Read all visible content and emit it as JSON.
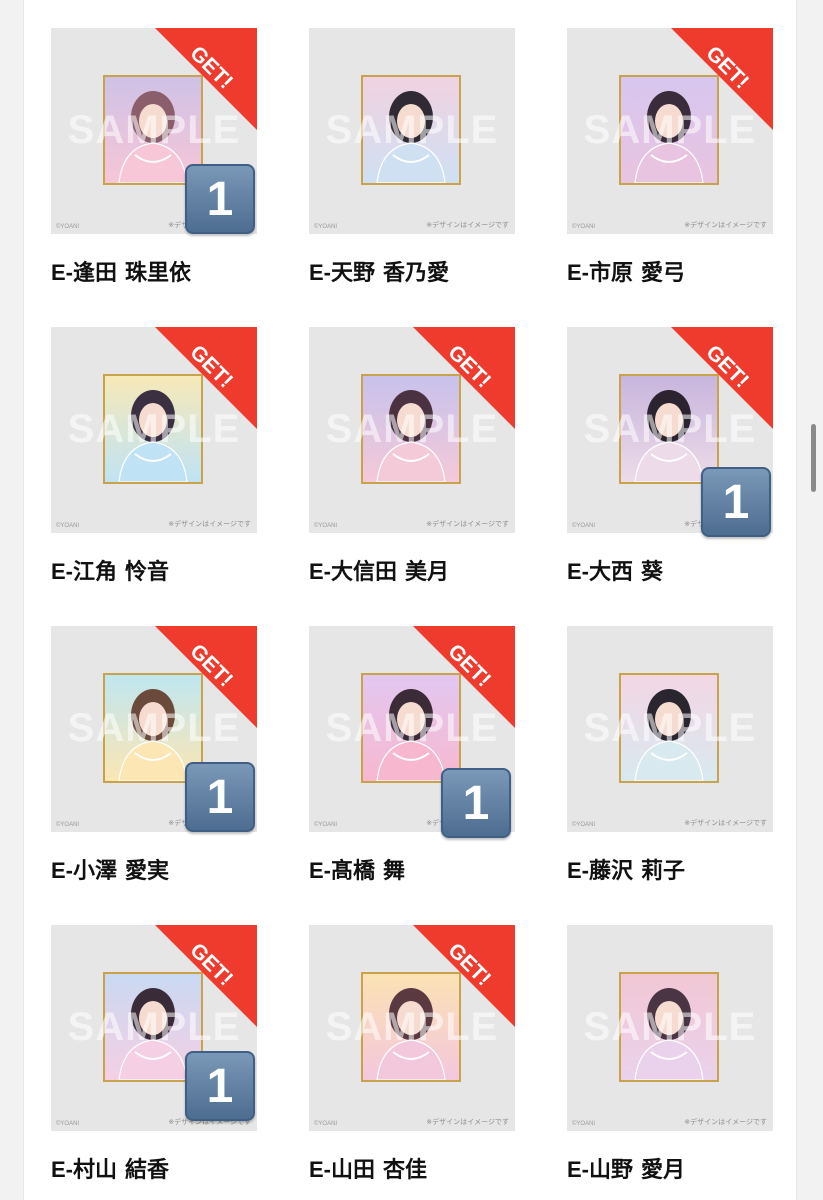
{
  "watermark": "SAMPLE",
  "ribbon_label": "GET!",
  "copyright": "©YOANI",
  "note": "※デザインはイメージです",
  "colors": {
    "ribbon": "#ee3b2e",
    "badge": "#5e7ea3",
    "frame": "#c9a34c"
  },
  "cards": [
    {
      "code": "E-",
      "surname": "逢田",
      "given": "珠里依",
      "get": true,
      "count": "1"
    },
    {
      "code": "E-",
      "surname": "天野",
      "given": "香乃愛",
      "get": false,
      "count": ""
    },
    {
      "code": "E-",
      "surname": "市原",
      "given": "愛弓",
      "get": true,
      "count": ""
    },
    {
      "code": "E-",
      "surname": "江角",
      "given": "怜音",
      "get": true,
      "count": ""
    },
    {
      "code": "E-",
      "surname": "大信田",
      "given": "美月",
      "get": true,
      "count": ""
    },
    {
      "code": "E-",
      "surname": "大西",
      "given": "葵",
      "get": true,
      "count": "1"
    },
    {
      "code": "E-",
      "surname": "小澤",
      "given": "愛実",
      "get": true,
      "count": "1"
    },
    {
      "code": "E-",
      "surname": "髙橋",
      "given": "舞",
      "get": true,
      "count": "1"
    },
    {
      "code": "E-",
      "surname": "藤沢",
      "given": "莉子",
      "get": false,
      "count": ""
    },
    {
      "code": "E-",
      "surname": "村山",
      "given": "結香",
      "get": true,
      "count": "1"
    },
    {
      "code": "E-",
      "surname": "山田",
      "given": "杏佳",
      "get": true,
      "count": ""
    },
    {
      "code": "E-",
      "surname": "山野",
      "given": "愛月",
      "get": false,
      "count": ""
    }
  ]
}
